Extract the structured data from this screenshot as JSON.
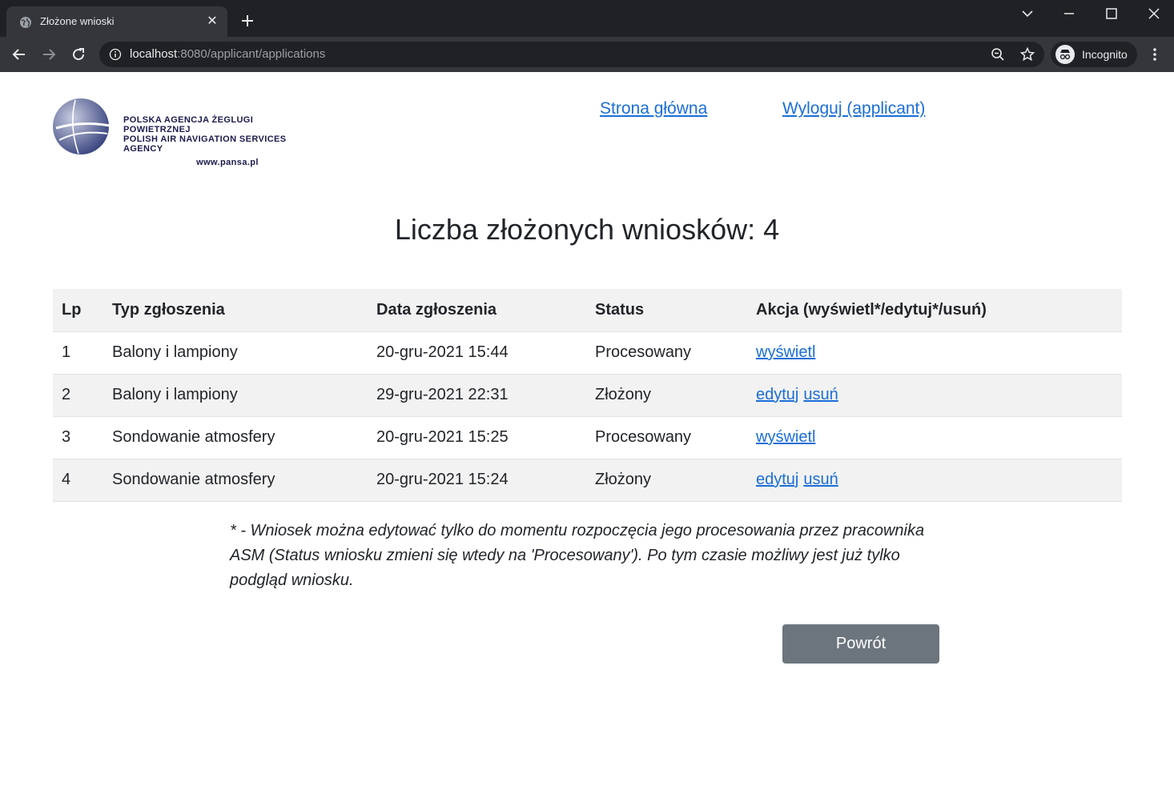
{
  "browser": {
    "tab_title": "Złożone wnioski",
    "url_host": "localhost",
    "url_rest": ":8080/applicant/applications",
    "profile_label": "Incognito"
  },
  "header": {
    "logo_line1": "POLSKA AGENCJA ŻEGLUGI POWIETRZNEJ",
    "logo_line2": "POLISH AIR NAVIGATION SERVICES AGENCY",
    "logo_www": "www.pansa.pl",
    "home_link": "Strona główna",
    "logout_link": "Wyloguj (applicant)"
  },
  "main": {
    "title": "Liczba złożonych wniosków: 4",
    "table": {
      "headers": [
        "Lp",
        "Typ zgłoszenia",
        "Data zgłoszenia",
        "Status",
        "Akcja (wyświetl*/edytuj*/usuń)"
      ],
      "rows": [
        {
          "lp": "1",
          "type": "Balony i lampiony",
          "date": "20-gru-2021 15:44",
          "status": "Procesowany",
          "action1": "wyświetl",
          "action2": ""
        },
        {
          "lp": "2",
          "type": "Balony i lampiony",
          "date": "29-gru-2021 22:31",
          "status": "Złożony",
          "action1": "edytuj",
          "action2": "usuń"
        },
        {
          "lp": "3",
          "type": "Sondowanie atmosfery",
          "date": "20-gru-2021 15:25",
          "status": "Procesowany",
          "action1": "wyświetl",
          "action2": ""
        },
        {
          "lp": "4",
          "type": "Sondowanie atmosfery",
          "date": "20-gru-2021 15:24",
          "status": "Złożony",
          "action1": "edytuj",
          "action2": "usuń"
        }
      ]
    },
    "note": "* - Wniosek można edytować tylko do momentu rozpoczęcia jego procesowania przez pracownika ASM (Status wniosku zmieni się wtedy na 'Procesowany'). Po tym czasie możliwy jest już tylko podgląd wniosku.",
    "back_button": "Powrót"
  },
  "colors": {
    "link": "#1a6ed8",
    "button": "#6c757d",
    "stripe": "#f2f2f2",
    "chrome_dark": "#202124",
    "chrome_toolbar": "#35363a"
  }
}
